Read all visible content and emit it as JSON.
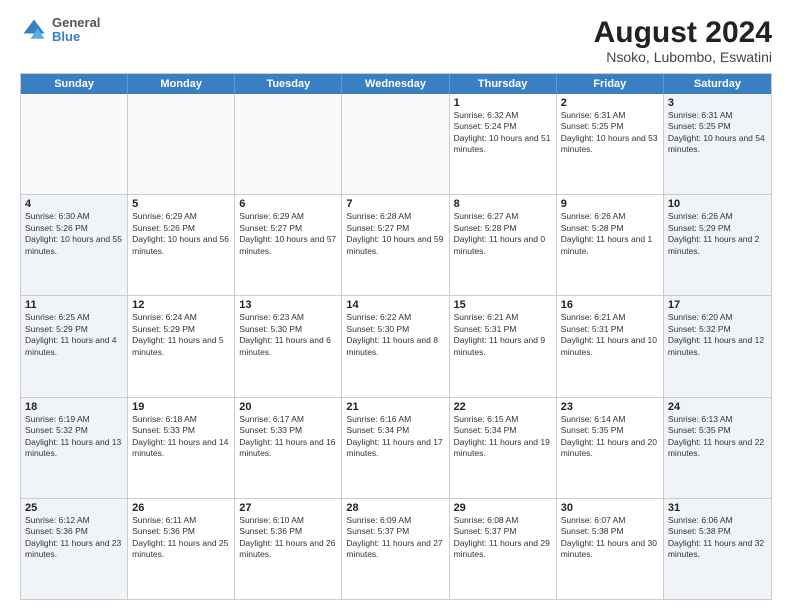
{
  "logo": {
    "line1": "General",
    "line2": "Blue"
  },
  "title": "August 2024",
  "subtitle": "Nsoko, Lubombo, Eswatini",
  "days_of_week": [
    "Sunday",
    "Monday",
    "Tuesday",
    "Wednesday",
    "Thursday",
    "Friday",
    "Saturday"
  ],
  "weeks": [
    [
      {
        "day": "",
        "empty": true
      },
      {
        "day": "",
        "empty": true
      },
      {
        "day": "",
        "empty": true
      },
      {
        "day": "",
        "empty": true
      },
      {
        "day": "1",
        "sunrise": "Sunrise: 6:32 AM",
        "sunset": "Sunset: 5:24 PM",
        "daylight": "Daylight: 10 hours and 51 minutes."
      },
      {
        "day": "2",
        "sunrise": "Sunrise: 6:31 AM",
        "sunset": "Sunset: 5:25 PM",
        "daylight": "Daylight: 10 hours and 53 minutes."
      },
      {
        "day": "3",
        "sunrise": "Sunrise: 6:31 AM",
        "sunset": "Sunset: 5:25 PM",
        "daylight": "Daylight: 10 hours and 54 minutes."
      }
    ],
    [
      {
        "day": "4",
        "sunrise": "Sunrise: 6:30 AM",
        "sunset": "Sunset: 5:26 PM",
        "daylight": "Daylight: 10 hours and 55 minutes."
      },
      {
        "day": "5",
        "sunrise": "Sunrise: 6:29 AM",
        "sunset": "Sunset: 5:26 PM",
        "daylight": "Daylight: 10 hours and 56 minutes."
      },
      {
        "day": "6",
        "sunrise": "Sunrise: 6:29 AM",
        "sunset": "Sunset: 5:27 PM",
        "daylight": "Daylight: 10 hours and 57 minutes."
      },
      {
        "day": "7",
        "sunrise": "Sunrise: 6:28 AM",
        "sunset": "Sunset: 5:27 PM",
        "daylight": "Daylight: 10 hours and 59 minutes."
      },
      {
        "day": "8",
        "sunrise": "Sunrise: 6:27 AM",
        "sunset": "Sunset: 5:28 PM",
        "daylight": "Daylight: 11 hours and 0 minutes."
      },
      {
        "day": "9",
        "sunrise": "Sunrise: 6:26 AM",
        "sunset": "Sunset: 5:28 PM",
        "daylight": "Daylight: 11 hours and 1 minute."
      },
      {
        "day": "10",
        "sunrise": "Sunrise: 6:26 AM",
        "sunset": "Sunset: 5:29 PM",
        "daylight": "Daylight: 11 hours and 2 minutes."
      }
    ],
    [
      {
        "day": "11",
        "sunrise": "Sunrise: 6:25 AM",
        "sunset": "Sunset: 5:29 PM",
        "daylight": "Daylight: 11 hours and 4 minutes."
      },
      {
        "day": "12",
        "sunrise": "Sunrise: 6:24 AM",
        "sunset": "Sunset: 5:29 PM",
        "daylight": "Daylight: 11 hours and 5 minutes."
      },
      {
        "day": "13",
        "sunrise": "Sunrise: 6:23 AM",
        "sunset": "Sunset: 5:30 PM",
        "daylight": "Daylight: 11 hours and 6 minutes."
      },
      {
        "day": "14",
        "sunrise": "Sunrise: 6:22 AM",
        "sunset": "Sunset: 5:30 PM",
        "daylight": "Daylight: 11 hours and 8 minutes."
      },
      {
        "day": "15",
        "sunrise": "Sunrise: 6:21 AM",
        "sunset": "Sunset: 5:31 PM",
        "daylight": "Daylight: 11 hours and 9 minutes."
      },
      {
        "day": "16",
        "sunrise": "Sunrise: 6:21 AM",
        "sunset": "Sunset: 5:31 PM",
        "daylight": "Daylight: 11 hours and 10 minutes."
      },
      {
        "day": "17",
        "sunrise": "Sunrise: 6:20 AM",
        "sunset": "Sunset: 5:32 PM",
        "daylight": "Daylight: 11 hours and 12 minutes."
      }
    ],
    [
      {
        "day": "18",
        "sunrise": "Sunrise: 6:19 AM",
        "sunset": "Sunset: 5:32 PM",
        "daylight": "Daylight: 11 hours and 13 minutes."
      },
      {
        "day": "19",
        "sunrise": "Sunrise: 6:18 AM",
        "sunset": "Sunset: 5:33 PM",
        "daylight": "Daylight: 11 hours and 14 minutes."
      },
      {
        "day": "20",
        "sunrise": "Sunrise: 6:17 AM",
        "sunset": "Sunset: 5:33 PM",
        "daylight": "Daylight: 11 hours and 16 minutes."
      },
      {
        "day": "21",
        "sunrise": "Sunrise: 6:16 AM",
        "sunset": "Sunset: 5:34 PM",
        "daylight": "Daylight: 11 hours and 17 minutes."
      },
      {
        "day": "22",
        "sunrise": "Sunrise: 6:15 AM",
        "sunset": "Sunset: 5:34 PM",
        "daylight": "Daylight: 11 hours and 19 minutes."
      },
      {
        "day": "23",
        "sunrise": "Sunrise: 6:14 AM",
        "sunset": "Sunset: 5:35 PM",
        "daylight": "Daylight: 11 hours and 20 minutes."
      },
      {
        "day": "24",
        "sunrise": "Sunrise: 6:13 AM",
        "sunset": "Sunset: 5:35 PM",
        "daylight": "Daylight: 11 hours and 22 minutes."
      }
    ],
    [
      {
        "day": "25",
        "sunrise": "Sunrise: 6:12 AM",
        "sunset": "Sunset: 5:36 PM",
        "daylight": "Daylight: 11 hours and 23 minutes."
      },
      {
        "day": "26",
        "sunrise": "Sunrise: 6:11 AM",
        "sunset": "Sunset: 5:36 PM",
        "daylight": "Daylight: 11 hours and 25 minutes."
      },
      {
        "day": "27",
        "sunrise": "Sunrise: 6:10 AM",
        "sunset": "Sunset: 5:36 PM",
        "daylight": "Daylight: 11 hours and 26 minutes."
      },
      {
        "day": "28",
        "sunrise": "Sunrise: 6:09 AM",
        "sunset": "Sunset: 5:37 PM",
        "daylight": "Daylight: 11 hours and 27 minutes."
      },
      {
        "day": "29",
        "sunrise": "Sunrise: 6:08 AM",
        "sunset": "Sunset: 5:37 PM",
        "daylight": "Daylight: 11 hours and 29 minutes."
      },
      {
        "day": "30",
        "sunrise": "Sunrise: 6:07 AM",
        "sunset": "Sunset: 5:38 PM",
        "daylight": "Daylight: 11 hours and 30 minutes."
      },
      {
        "day": "31",
        "sunrise": "Sunrise: 6:06 AM",
        "sunset": "Sunset: 5:38 PM",
        "daylight": "Daylight: 11 hours and 32 minutes."
      }
    ]
  ]
}
